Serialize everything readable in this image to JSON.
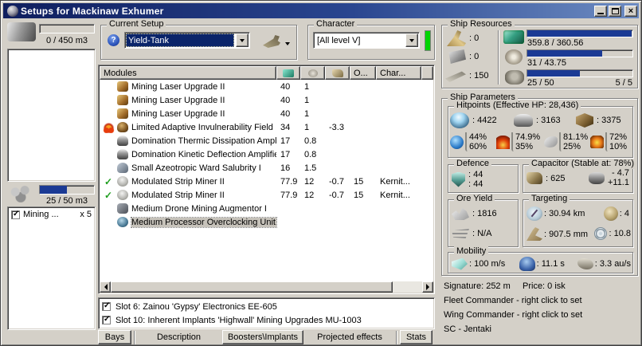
{
  "colors": {
    "titlebar_from": "#0f1e5e",
    "titlebar_to": "#6d8cc2",
    "bar_fill": "#1b3a94",
    "green_indicator": "#00d400",
    "check_green": "#1e9e1e",
    "selection_bg": "#0a246a"
  },
  "window": {
    "title": "Setups for Mackinaw Exhumer"
  },
  "left_panel": {
    "cargo_label": "0 / 450 m3",
    "cargo_fill_pct": 0,
    "drone_label": "25 / 50 m3",
    "drone_fill_pct": 50,
    "drone_item": {
      "label": "Mining ...",
      "qty": "x 5"
    }
  },
  "current_setup": {
    "group_label": "Current Setup",
    "help": "?",
    "value": "Yield-Tank"
  },
  "character": {
    "group_label": "Character",
    "value": "[All level V]"
  },
  "modules": {
    "header": {
      "name": "Modules",
      "o": "O...",
      "char": "Char..."
    },
    "rows": [
      {
        "name": "Mining Laser Upgrade II",
        "cpu": "40",
        "pg": "1",
        "cap": "",
        "o": "",
        "char": ""
      },
      {
        "name": "Mining Laser Upgrade II",
        "cpu": "40",
        "pg": "1",
        "cap": "",
        "o": "",
        "char": ""
      },
      {
        "name": "Mining Laser Upgrade II",
        "cpu": "40",
        "pg": "1",
        "cap": "",
        "o": "",
        "char": ""
      },
      {
        "name": "Limited Adaptive Invulnerability Field I",
        "cpu": "34",
        "pg": "1",
        "cap": "-3.3",
        "o": "",
        "char": ""
      },
      {
        "name": "Domination Thermic Dissipation Amplifier",
        "cpu": "17",
        "pg": "0.8",
        "cap": "",
        "o": "",
        "char": ""
      },
      {
        "name": "Domination Kinetic Deflection Amplifier",
        "cpu": "17",
        "pg": "0.8",
        "cap": "",
        "o": "",
        "char": ""
      },
      {
        "name": "Small Azeotropic Ward Salubrity I",
        "cpu": "16",
        "pg": "1.5",
        "cap": "",
        "o": "",
        "char": ""
      },
      {
        "name": "Modulated Strip Miner II",
        "cpu": "77.9",
        "pg": "12",
        "cap": "-0.7",
        "o": "15",
        "char": "Kernit..."
      },
      {
        "name": "Modulated Strip Miner II",
        "cpu": "77.9",
        "pg": "12",
        "cap": "-0.7",
        "o": "15",
        "char": "Kernit..."
      },
      {
        "name": "Medium Drone Mining Augmentor I",
        "cpu": "",
        "pg": "",
        "cap": "",
        "o": "",
        "char": ""
      },
      {
        "name": "Medium Processor Overclocking Unit I",
        "cpu": "",
        "pg": "",
        "cap": "",
        "o": "",
        "char": ""
      }
    ]
  },
  "implants": {
    "items": [
      "Slot 6: Zainou 'Gypsy' Electronics EE-605",
      "Slot 10: Inherent Implants 'Highwall' Mining Upgrades MU-1003"
    ]
  },
  "tabs": {
    "bays": "Bays",
    "description": "Description",
    "boosters": "Boosters\\Implants",
    "projected": "Projected effects",
    "stats": "Stats"
  },
  "ship_resources": {
    "group_label": "Ship Resources",
    "turrets": ": 0",
    "launchers": ": 0",
    "calibration": ": 150",
    "cpu": {
      "text": "359.8 / 360.56",
      "pct": 99.5
    },
    "powergrid": {
      "text": "31 / 43.75",
      "pct": 71
    },
    "dronebay": {
      "text": "25 / 50",
      "pct": 50,
      "bandwidth": "5 / 5"
    }
  },
  "ship_parameters": {
    "group_label": "Ship Parameters",
    "hitpoints": {
      "group_label": "Hitpoints (Effective HP: 28,436)",
      "shield": ": 4422",
      "armor": ": 3163",
      "hull": ": 3375",
      "resists": {
        "em_top": "44%",
        "em_bottom": "60%",
        "thermal_top": "74.9%",
        "thermal_bottom": "35%",
        "kinetic_top": "81.1%",
        "kinetic_bottom": "25%",
        "explosive_top": "72%",
        "explosive_bottom": "10%"
      }
    },
    "defence": {
      "group_label": "Defence",
      "top": ": 44",
      "bottom": ": 44"
    },
    "capacitor": {
      "group_label": "Capacitor (Stable at: 78%)",
      "capacity": ": 625",
      "usage": "- 4.7",
      "recharge": "+11.1"
    },
    "ore_yield": {
      "group_label": "Ore Yield",
      "ore": ": 1816",
      "gas": ": N/A"
    },
    "targeting": {
      "group_label": "Targeting",
      "range": ": 30.94 km",
      "max_targets": ": 4",
      "scan_resolution": ": 907.5 mm",
      "sensor_strength": ": 10.8"
    },
    "mobility": {
      "group_label": "Mobility",
      "speed": ": 100 m/s",
      "align_time": ": 11.1 s",
      "warp_speed": ": 3.3 au/s"
    }
  },
  "footer": {
    "signature": "Signature: 252 m",
    "price": "Price: 0 isk",
    "fleet": "Fleet Commander - right click to set",
    "wing": "Wing Commander - right click to set",
    "sc": "SC - Jentaki"
  }
}
